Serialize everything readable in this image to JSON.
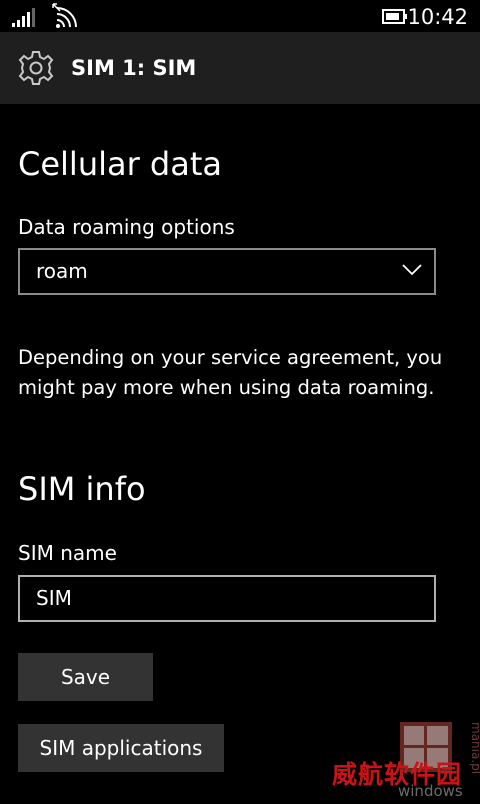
{
  "status_bar": {
    "time": "10:42",
    "icons": [
      "signal-strength-icon",
      "wifi-icon",
      "battery-icon"
    ]
  },
  "header": {
    "title": "SIM 1: SIM",
    "icon": "gear-icon"
  },
  "cellular_data": {
    "title": "Cellular data",
    "roaming_label": "Data roaming options",
    "roaming_value": "roam",
    "roaming_note": "Depending on your service agreement, you might pay more when using data roaming."
  },
  "sim_info": {
    "title": "SIM info",
    "name_label": "SIM name",
    "name_value": "SIM",
    "save_button": "Save",
    "applications_button": "SIM applications"
  },
  "watermark": {
    "chinese_text": "威航软件园",
    "logo_text": "windowsmania.pl"
  },
  "colors": {
    "background": "#000000",
    "header_background": "#1f1f1f",
    "button_background": "#333333",
    "field_border": "#8a8a8a",
    "text": "#ffffff",
    "watermark_red": "#c81418"
  }
}
